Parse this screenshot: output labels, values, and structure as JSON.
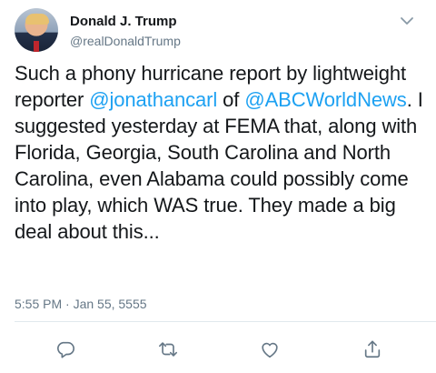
{
  "author": {
    "name": "Donald J. Trump",
    "handle": "@realDonaldTrump"
  },
  "tweet": {
    "text_part1": "Such a phony hurricane report by lightweight reporter ",
    "mention1": "@jonathancarl",
    "text_part2": " of ",
    "mention2": "@ABCWorldNews",
    "text_part3": ". I suggested yesterday at FEMA that, along with Florida, Georgia, South Carolina and North Carolina, even Alabama could possibly come into play, which WAS true. They made a big deal about this...",
    "timestamp": "5:55 PM · Jan 55, 5555"
  },
  "icons": {
    "menu": "chevron-down-icon",
    "reply": "reply-icon",
    "retweet": "retweet-icon",
    "like": "like-icon",
    "share": "share-icon"
  },
  "colors": {
    "link": "#1da1f2",
    "secondary_text": "#657786",
    "divider": "#e1e8ed"
  }
}
